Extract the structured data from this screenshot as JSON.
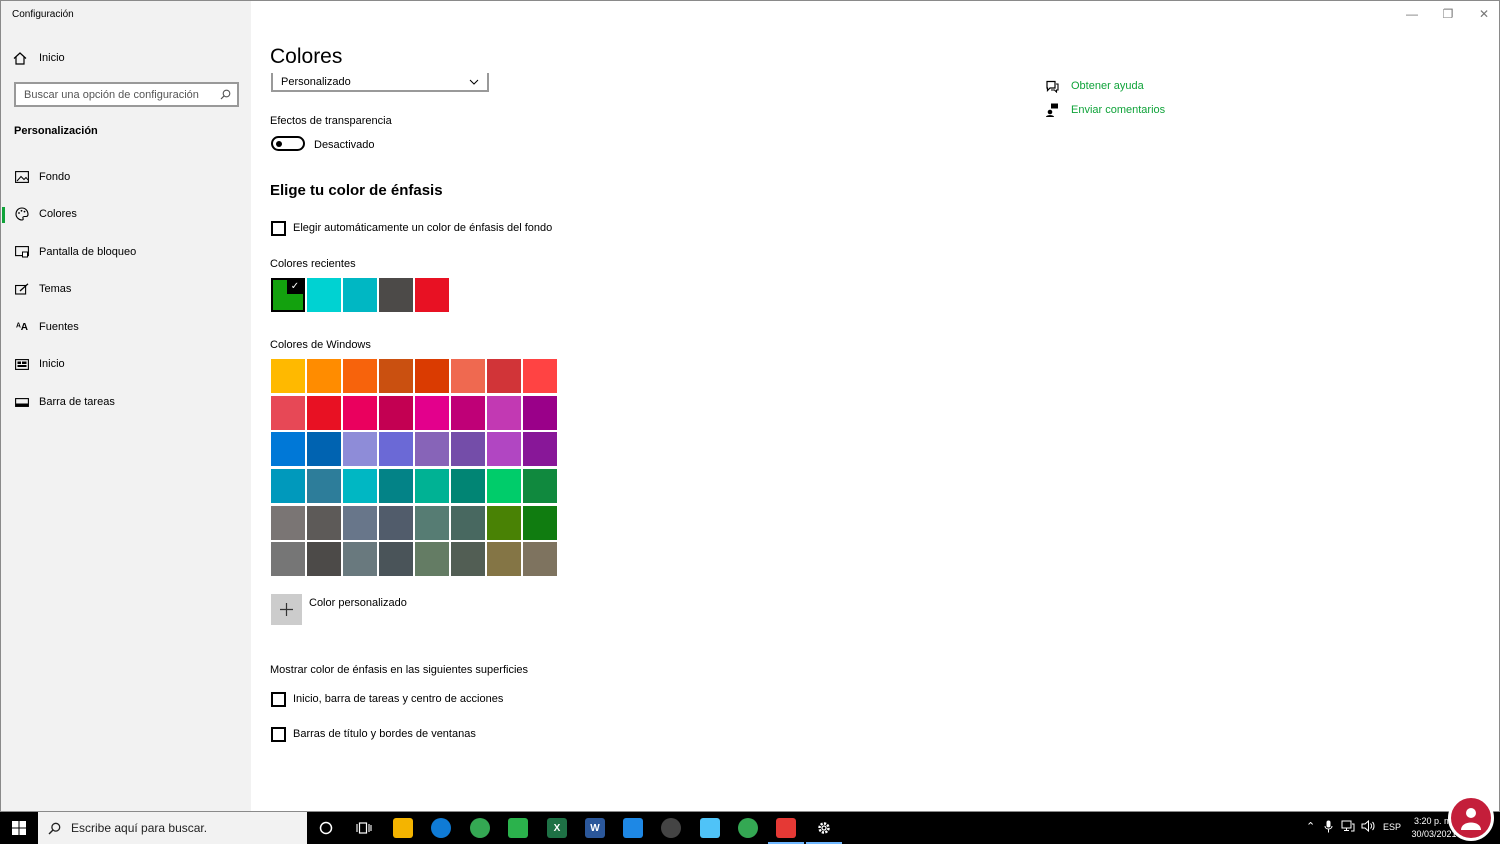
{
  "window": {
    "title": "Configuración",
    "controls": {
      "minimize": "—",
      "restore": "❐",
      "close": "✕"
    }
  },
  "sidebar": {
    "home_label": "Inicio",
    "search_placeholder": "Buscar una opción de configuración",
    "section_label": "Personalización",
    "items": [
      {
        "label": "Fondo",
        "icon": "image-icon"
      },
      {
        "label": "Colores",
        "icon": "palette-icon",
        "active": true
      },
      {
        "label": "Pantalla de bloqueo",
        "icon": "lock-screen-icon"
      },
      {
        "label": "Temas",
        "icon": "themes-icon"
      },
      {
        "label": "Fuentes",
        "icon": "fonts-icon"
      },
      {
        "label": "Inicio",
        "icon": "start-icon"
      },
      {
        "label": "Barra de tareas",
        "icon": "taskbar-icon"
      }
    ]
  },
  "main": {
    "title": "Colores",
    "mode_dropdown_value": "Personalizado",
    "transparency_label": "Efectos de transparencia",
    "transparency_state": "Desactivado",
    "accent_heading": "Elige tu color de énfasis",
    "auto_accent_label": "Elegir automáticamente un color de énfasis del fondo",
    "recent_label": "Colores recientes",
    "recent_colors": [
      "#13a10e",
      "#00d2d2",
      "#00b7c3",
      "#4c4a48",
      "#e81123"
    ],
    "windows_label": "Colores de Windows",
    "windows_colors": [
      "#ffb900",
      "#ff8c00",
      "#f7630c",
      "#ca5010",
      "#da3b01",
      "#ef6950",
      "#d13438",
      "#ff4343",
      "#e74856",
      "#e81123",
      "#ea005e",
      "#c30052",
      "#e3008c",
      "#bf0077",
      "#c239b3",
      "#9a0089",
      "#0078d7",
      "#0063b1",
      "#8e8cd8",
      "#6b69d6",
      "#8764b8",
      "#744da9",
      "#b146c2",
      "#881798",
      "#0099bc",
      "#2d7d9a",
      "#00b7c3",
      "#038387",
      "#00b294",
      "#018574",
      "#00cc6a",
      "#10893e",
      "#7a7574",
      "#5d5a58",
      "#68768a",
      "#515c6b",
      "#567c73",
      "#486860",
      "#498205",
      "#107c10",
      "#767676",
      "#4c4a48",
      "#69797e",
      "#4a5459",
      "#647c64",
      "#525e54",
      "#847545",
      "#7e735f"
    ],
    "custom_color_label": "Color personalizado",
    "surfaces_label": "Mostrar color de énfasis en las siguientes superficies",
    "surface_options": [
      "Inicio, barra de tareas y centro de acciones",
      "Barras de título y bordes de ventanas"
    ]
  },
  "help": {
    "get_help": "Obtener ayuda",
    "feedback": "Enviar comentarios"
  },
  "taskbar": {
    "search_placeholder": "Escribe aquí para buscar.",
    "language": "ESP",
    "time": "3:20 p. m.",
    "date": "30/03/2021"
  },
  "colors": {
    "accent": "#10a33a",
    "sidebar_bg": "#f2f2f2",
    "taskbar_bg": "#000000"
  }
}
